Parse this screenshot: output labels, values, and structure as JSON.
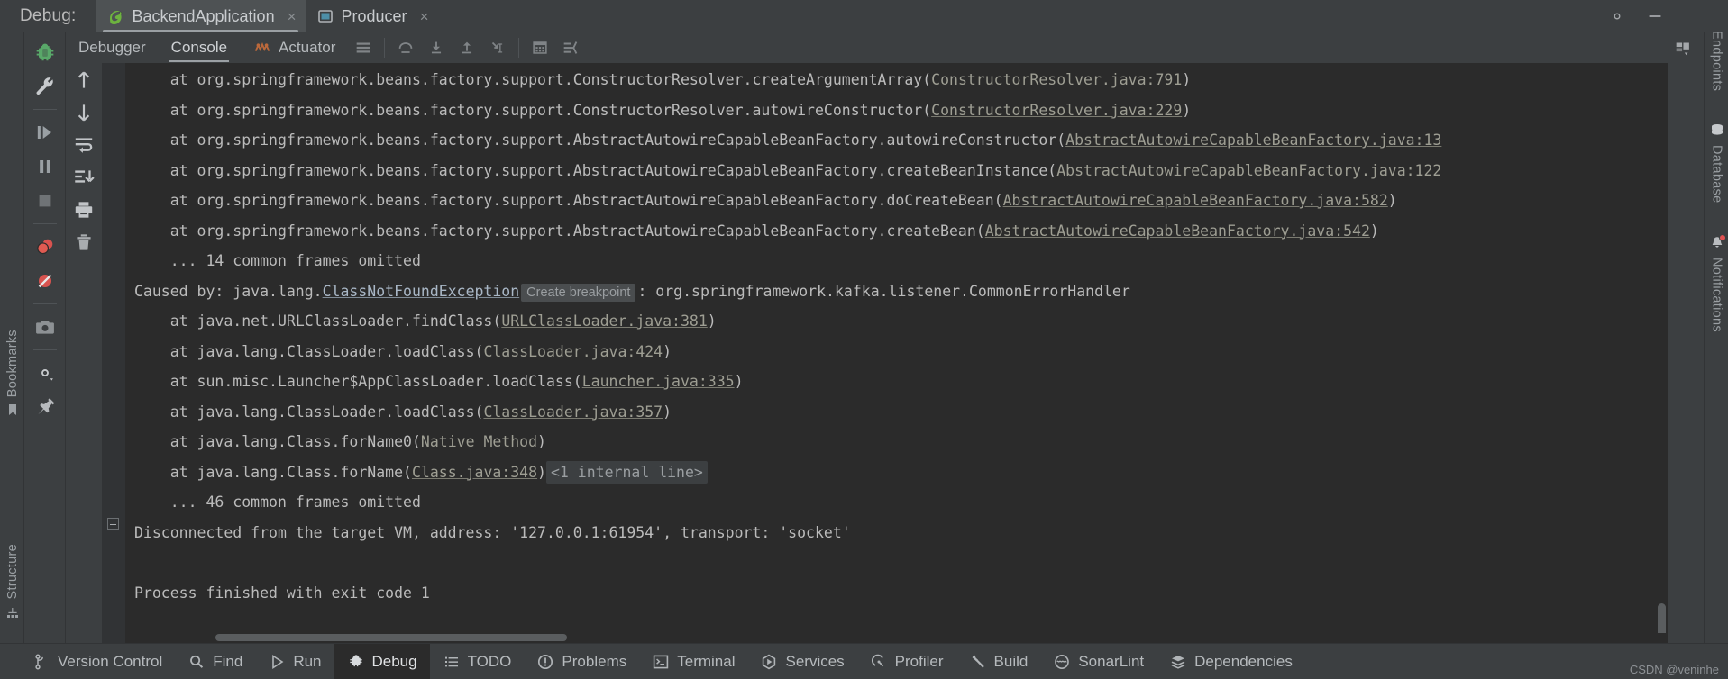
{
  "window": {
    "debug_label": "Debug:",
    "tabs": [
      {
        "title": "BackendApplication",
        "icon": "spring-boot-icon",
        "active": true,
        "close": "×"
      },
      {
        "title": "Producer",
        "icon": "application-icon",
        "active": false,
        "close": "×"
      }
    ],
    "controls": [
      {
        "name": "settings-gear-icon"
      },
      {
        "name": "minimize-icon"
      }
    ]
  },
  "debug_toolbar": {
    "icons": [
      {
        "name": "debug-bug-icon"
      },
      {
        "name": "wrench-settings-icon"
      },
      {
        "name": "resume-program-icon"
      },
      {
        "name": "pause-program-icon"
      },
      {
        "name": "stop-program-icon"
      },
      {
        "name": "view-breakpoints-icon"
      },
      {
        "name": "mute-breakpoints-icon"
      },
      {
        "name": "camera-snapshot-icon"
      },
      {
        "name": "settings-dropdown-icon"
      },
      {
        "name": "pin-tab-icon"
      }
    ]
  },
  "run_actions": {
    "icons": [
      {
        "name": "step-up-icon"
      },
      {
        "name": "step-down-icon"
      },
      {
        "name": "soft-wrap-icon"
      },
      {
        "name": "scroll-to-end-icon"
      },
      {
        "name": "print-icon"
      },
      {
        "name": "trash-icon"
      }
    ]
  },
  "console_toolbar": {
    "tabs": [
      {
        "label": "Debugger",
        "icon": "",
        "active": false
      },
      {
        "label": "Console",
        "icon": "",
        "active": true
      },
      {
        "label": "Actuator",
        "icon": "actuator-icon",
        "active": false
      }
    ],
    "buttons": [
      {
        "name": "layout-settings-icon"
      },
      {
        "name": "force-step-over-icon"
      },
      {
        "name": "step-into-icon"
      },
      {
        "name": "step-out-icon"
      },
      {
        "name": "run-to-cursor-icon"
      },
      {
        "name": "evaluate-expression-icon"
      },
      {
        "name": "threads-and-variables-icon"
      }
    ],
    "right_button": {
      "name": "layout-restore-icon"
    }
  },
  "left_tool_window": {
    "items": [
      {
        "label": "Bookmarks",
        "icon": "bookmark-icon"
      },
      {
        "label": "Structure",
        "icon": "structure-icon"
      }
    ]
  },
  "right_tool_window": {
    "items": [
      {
        "label": "Endpoints",
        "icon": "endpoints-icon",
        "badge": false
      },
      {
        "label": "Database",
        "icon": "database-icon",
        "badge": false
      },
      {
        "label": "Notifications",
        "icon": "bell-icon",
        "badge": true
      }
    ]
  },
  "console": {
    "lines": [
      {
        "indent": 4,
        "segments": [
          {
            "t": "at org.springframework.beans.factory.support.ConstructorResolver.createArgumentArray(",
            "k": "plain"
          },
          {
            "t": "ConstructorResolver.java:791",
            "k": "link"
          },
          {
            "t": ")",
            "k": "plain"
          }
        ]
      },
      {
        "indent": 4,
        "segments": [
          {
            "t": "at org.springframework.beans.factory.support.ConstructorResolver.autowireConstructor(",
            "k": "plain"
          },
          {
            "t": "ConstructorResolver.java:229",
            "k": "link"
          },
          {
            "t": ")",
            "k": "plain"
          }
        ]
      },
      {
        "indent": 4,
        "segments": [
          {
            "t": "at org.springframework.beans.factory.support.AbstractAutowireCapableBeanFactory.autowireConstructor(",
            "k": "plain"
          },
          {
            "t": "AbstractAutowireCapableBeanFactory.java:13",
            "k": "link"
          }
        ]
      },
      {
        "indent": 4,
        "segments": [
          {
            "t": "at org.springframework.beans.factory.support.AbstractAutowireCapableBeanFactory.createBeanInstance(",
            "k": "plain"
          },
          {
            "t": "AbstractAutowireCapableBeanFactory.java:122",
            "k": "link"
          }
        ]
      },
      {
        "indent": 4,
        "segments": [
          {
            "t": "at org.springframework.beans.factory.support.AbstractAutowireCapableBeanFactory.doCreateBean(",
            "k": "plain"
          },
          {
            "t": "AbstractAutowireCapableBeanFactory.java:582",
            "k": "link"
          },
          {
            "t": ")",
            "k": "plain"
          }
        ]
      },
      {
        "indent": 4,
        "segments": [
          {
            "t": "at org.springframework.beans.factory.support.AbstractAutowireCapableBeanFactory.createBean(",
            "k": "plain"
          },
          {
            "t": "AbstractAutowireCapableBeanFactory.java:542",
            "k": "link"
          },
          {
            "t": ")",
            "k": "plain"
          }
        ]
      },
      {
        "indent": 4,
        "segments": [
          {
            "t": "... 14 common frames omitted",
            "k": "plain"
          }
        ]
      },
      {
        "indent": 0,
        "segments": [
          {
            "t": "Caused by: java.lang.",
            "k": "plain"
          },
          {
            "t": "ClassNotFoundException",
            "k": "exception"
          },
          {
            "t": "Create breakpoint",
            "k": "chip"
          },
          {
            "t": ": org.springframework.kafka.listener.CommonErrorHandler",
            "k": "plain"
          }
        ]
      },
      {
        "indent": 4,
        "segments": [
          {
            "t": "at java.net.URLClassLoader.findClass(",
            "k": "plain"
          },
          {
            "t": "URLClassLoader.java:381",
            "k": "link"
          },
          {
            "t": ")",
            "k": "plain"
          }
        ]
      },
      {
        "indent": 4,
        "segments": [
          {
            "t": "at java.lang.ClassLoader.loadClass(",
            "k": "plain"
          },
          {
            "t": "ClassLoader.java:424",
            "k": "link"
          },
          {
            "t": ")",
            "k": "plain"
          }
        ]
      },
      {
        "indent": 4,
        "segments": [
          {
            "t": "at sun.misc.Launcher$AppClassLoader.loadClass(",
            "k": "plain"
          },
          {
            "t": "Launcher.java:335",
            "k": "link"
          },
          {
            "t": ")",
            "k": "plain"
          }
        ]
      },
      {
        "indent": 4,
        "segments": [
          {
            "t": "at java.lang.ClassLoader.loadClass(",
            "k": "plain"
          },
          {
            "t": "ClassLoader.java:357",
            "k": "link"
          },
          {
            "t": ")",
            "k": "plain"
          }
        ]
      },
      {
        "indent": 4,
        "segments": [
          {
            "t": "at java.lang.Class.forName0(",
            "k": "plain"
          },
          {
            "t": "Native Method",
            "k": "link"
          },
          {
            "t": ")",
            "k": "plain"
          }
        ]
      },
      {
        "indent": 4,
        "fold": true,
        "segments": [
          {
            "t": "at java.lang.Class.forName(",
            "k": "plain"
          },
          {
            "t": "Class.java:348",
            "k": "link"
          },
          {
            "t": ")",
            "k": "plain"
          },
          {
            "t": "<1 internal line>",
            "k": "internal"
          }
        ]
      },
      {
        "indent": 4,
        "segments": [
          {
            "t": "... 46 common frames omitted",
            "k": "plain"
          }
        ]
      },
      {
        "indent": 0,
        "segments": [
          {
            "t": "Disconnected from the target VM, address: '127.0.0.1:61954', transport: 'socket'",
            "k": "plain"
          }
        ]
      },
      {
        "indent": 0,
        "segments": [
          {
            "t": "",
            "k": "plain"
          }
        ]
      },
      {
        "indent": 0,
        "segments": [
          {
            "t": "Process finished with exit code 1",
            "k": "plain"
          }
        ]
      }
    ]
  },
  "bottom_bar": {
    "items": [
      {
        "label": "Version Control",
        "icon": "branch-icon",
        "active": false
      },
      {
        "label": "Find",
        "icon": "search-icon",
        "active": false
      },
      {
        "label": "Run",
        "icon": "play-icon",
        "active": false
      },
      {
        "label": "Debug",
        "icon": "bug-icon",
        "active": true
      },
      {
        "label": "TODO",
        "icon": "list-icon",
        "active": false
      },
      {
        "label": "Problems",
        "icon": "warning-icon",
        "active": false
      },
      {
        "label": "Terminal",
        "icon": "terminal-icon",
        "active": false
      },
      {
        "label": "Services",
        "icon": "services-icon",
        "active": false
      },
      {
        "label": "Profiler",
        "icon": "profiler-icon",
        "active": false
      },
      {
        "label": "Build",
        "icon": "hammer-icon",
        "active": false
      },
      {
        "label": "SonarLint",
        "icon": "sonarlint-icon",
        "active": false
      },
      {
        "label": "Dependencies",
        "icon": "layers-icon",
        "active": false
      }
    ],
    "watermark": "CSDN @veninhe"
  },
  "colors": {
    "background": "#3c3f41",
    "console_background": "#2b2b2b",
    "text": "#a9b7c6",
    "link": "#9e9e93",
    "accent_green": "#6db33f",
    "accent_red": "#d9534f"
  }
}
